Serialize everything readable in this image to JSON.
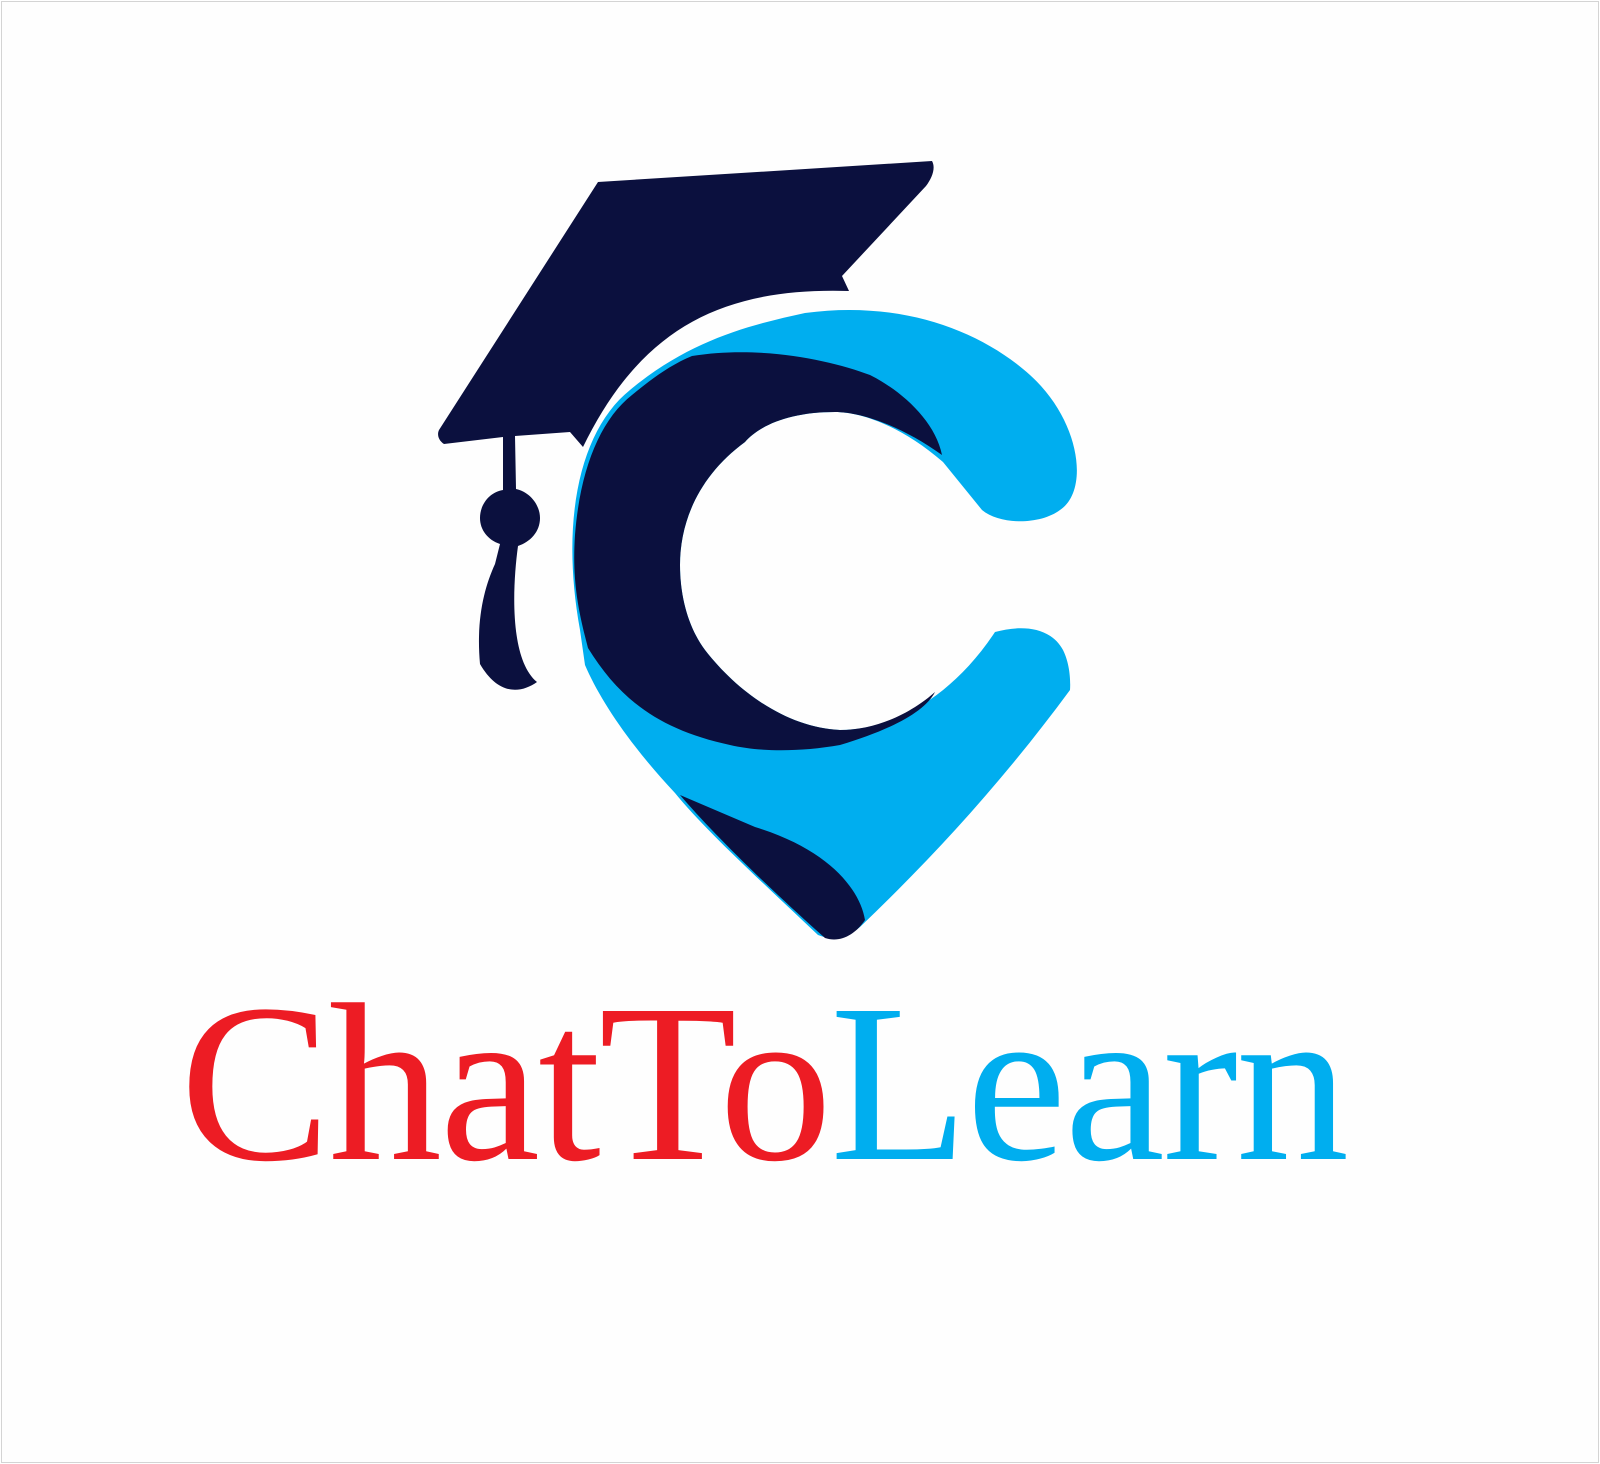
{
  "logo": {
    "brand_part_1": "ChatTo",
    "brand_part_2": "Learn",
    "colors": {
      "navy": "#0b103e",
      "sky_blue": "#00aeef",
      "red": "#ed1c24"
    },
    "icon": "graduation-cap-c-pin-icon"
  }
}
